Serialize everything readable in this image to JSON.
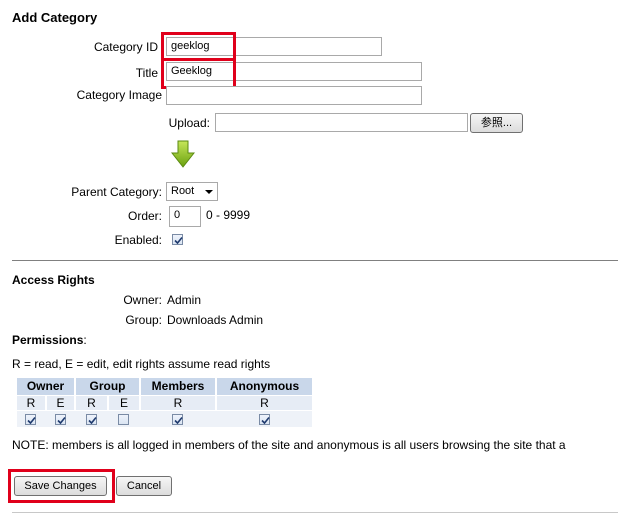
{
  "form": {
    "title": "Add Category",
    "category_id_label": "Category ID",
    "category_id_value": "geeklog",
    "title_label": "Title",
    "title_value": "Geeklog",
    "image_label": "Category Image",
    "image_value": "",
    "upload_label": "Upload:",
    "upload_value": "",
    "browse_button": "参照...",
    "parent_label": "Parent Category:",
    "parent_selected": "Root",
    "order_label": "Order:",
    "order_value": "0",
    "order_range": "0 - 9999",
    "enabled_label": "Enabled:",
    "enabled_checked": true
  },
  "access": {
    "heading": "Access Rights",
    "owner_label": "Owner:",
    "owner_value": "Admin",
    "group_label": "Group:",
    "group_value": "Downloads Admin"
  },
  "permissions": {
    "heading": "Permissions",
    "colon": ":",
    "legend": "R = read, E = edit, edit rights assume read rights",
    "columns": [
      "Owner",
      "Group",
      "Members",
      "Anonymous"
    ],
    "subheaders": {
      "r": "R",
      "e": "E"
    },
    "checked": {
      "owner_r": true,
      "owner_e": true,
      "group_r": true,
      "group_e": false,
      "members_r": true,
      "anonymous_r": true
    },
    "note": "NOTE: members is all logged in members of the site and anonymous is all users browsing the site that a"
  },
  "actions": {
    "save_label": "Save Changes",
    "cancel_label": "Cancel"
  },
  "colors": {
    "highlight": "#e0001b",
    "table_header": "#c9d7ea",
    "arrow": "#8ac017"
  }
}
